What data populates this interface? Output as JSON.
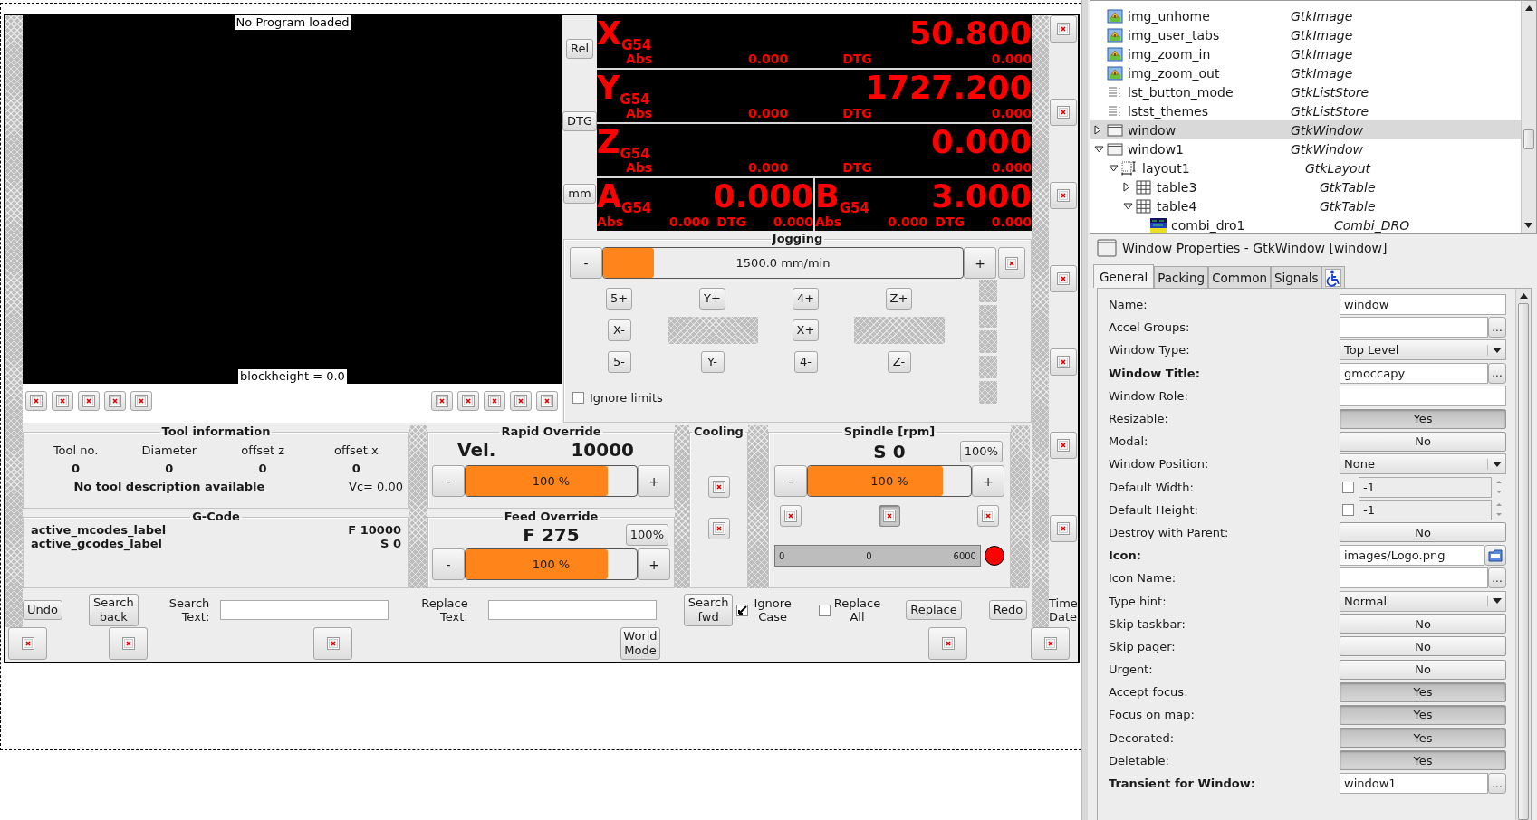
{
  "canvas": {
    "app": {
      "preview": {
        "title": "No Program loaded",
        "footer": "blockheight = 0.0"
      },
      "dro_buttons": [
        "Rel",
        "DTG",
        "mm"
      ],
      "dro": {
        "rows": [
          {
            "axes": [
              {
                "letter": "X",
                "system": "G54",
                "value": "50.800",
                "abs_label": "Abs",
                "abs_value": "0.000",
                "dtg_label": "DTG",
                "dtg_value": "0.000"
              }
            ]
          },
          {
            "axes": [
              {
                "letter": "Y",
                "system": "G54",
                "value": "1727.200",
                "abs_label": "Abs",
                "abs_value": "0.000",
                "dtg_label": "DTG",
                "dtg_value": "0.000"
              }
            ]
          },
          {
            "axes": [
              {
                "letter": "Z",
                "system": "G54",
                "value": "0.000",
                "abs_label": "Abs",
                "abs_value": "0.000",
                "dtg_label": "DTG",
                "dtg_value": "0.000"
              }
            ]
          },
          {
            "axes": [
              {
                "letter": "A",
                "system": "G54",
                "value": "0.000",
                "abs_label": "Abs",
                "abs_value": "0.000",
                "dtg_label": "DTG",
                "dtg_value": "0.000"
              },
              {
                "letter": "B",
                "system": "G54",
                "value": "3.000",
                "abs_label": "Abs",
                "abs_value": "0.000",
                "dtg_label": "DTG",
                "dtg_value": "0.000"
              }
            ]
          }
        ]
      },
      "jogging": {
        "title": "Jogging",
        "speed": {
          "minus": "-",
          "plus": "+",
          "reading": "1500.0 mm/min",
          "level": 0.14
        },
        "grid": [
          {
            "kind": "button",
            "label": "5+"
          },
          {
            "kind": "button",
            "label": "Y+"
          },
          {
            "kind": "button",
            "label": "4+"
          },
          {
            "kind": "button",
            "label": "Z+"
          },
          {
            "kind": "button",
            "label": "X-"
          },
          {
            "kind": "placeholder"
          },
          {
            "kind": "button",
            "label": "X+"
          },
          {
            "kind": "placeholder"
          },
          {
            "kind": "button",
            "label": "5-"
          },
          {
            "kind": "button",
            "label": "Y-"
          },
          {
            "kind": "button",
            "label": "4-"
          },
          {
            "kind": "button",
            "label": "Z-"
          }
        ],
        "ignore_limits": {
          "label": "Ignore limits",
          "checked": false
        }
      },
      "tool_info": {
        "title": "Tool information",
        "columns": [
          "Tool no.",
          "Diameter",
          "offset z",
          "offset x"
        ],
        "values": [
          "0",
          "0",
          "0",
          "0"
        ],
        "description": "No tool description available",
        "vc": "Vc= 0.00"
      },
      "gcode": {
        "title": "G-Code",
        "rows": [
          {
            "label": "active_mcodes_label",
            "value": "F 10000"
          },
          {
            "label": "active_gcodes_label",
            "value": "S 0"
          }
        ]
      },
      "rapid_override": {
        "title": "Rapid Override",
        "label": "Vel.",
        "value": "10000",
        "slider": {
          "minus": "-",
          "plus": "+",
          "reading": "100 %",
          "level": 0.83
        }
      },
      "feed_override": {
        "title": "Feed Override",
        "value": "F 275",
        "reset": "100%",
        "slider": {
          "minus": "-",
          "plus": "+",
          "reading": "100 %",
          "level": 0.83
        }
      },
      "cooling": {
        "title": "Cooling"
      },
      "spindle": {
        "title": "Spindle [rpm]",
        "value": "S 0",
        "reset": "100%",
        "slider": {
          "minus": "-",
          "plus": "+",
          "reading": "100 %",
          "level": 0.83
        },
        "direction_buttons": [
          {
            "selected": false
          },
          {
            "selected": true
          },
          {
            "selected": false
          }
        ],
        "gauge": {
          "min": "0",
          "value": "0",
          "max": "6000"
        },
        "led": {
          "on": true
        }
      },
      "search_bar": {
        "undo": "Undo",
        "search_back": "Search\nback",
        "search_label": "Search\nText:",
        "replace_label": "Replace\nText:",
        "search_fwd": "Search\nfwd",
        "ignore_case": {
          "label": "Ignore\nCase",
          "checked": true
        },
        "replace_all": {
          "label": "Replace\nAll",
          "checked": false
        },
        "replace": "Replace",
        "redo": "Redo"
      },
      "time_date": "Time\nDate",
      "world_mode": "World\nMode"
    }
  },
  "object_tree": {
    "items": [
      {
        "name": "img_unhome",
        "type": "GtkImage",
        "kind": "image",
        "selected": false
      },
      {
        "name": "img_user_tabs",
        "type": "GtkImage",
        "kind": "image",
        "selected": false
      },
      {
        "name": "img_zoom_in",
        "type": "GtkImage",
        "kind": "image",
        "selected": false
      },
      {
        "name": "img_zoom_out",
        "type": "GtkImage",
        "kind": "image",
        "selected": false
      },
      {
        "name": "lst_button_mode",
        "type": "GtkListStore",
        "kind": "liststore",
        "selected": false
      },
      {
        "name": "lstst_themes",
        "type": "GtkListStore",
        "kind": "liststore",
        "selected": false
      },
      {
        "name": "window",
        "type": "GtkWindow",
        "kind": "window",
        "expanded": false,
        "selected": true
      },
      {
        "name": "window1",
        "type": "GtkWindow",
        "kind": "window",
        "expanded": true,
        "selected": false,
        "children": [
          {
            "name": "layout1",
            "type": "GtkLayout",
            "kind": "layout",
            "expanded": true,
            "selected": false,
            "children": [
              {
                "name": "table3",
                "type": "GtkTable",
                "kind": "table",
                "expanded": false,
                "selected": false
              },
              {
                "name": "table4",
                "type": "GtkTable",
                "kind": "table",
                "expanded": true,
                "selected": false,
                "children": [
                  {
                    "name": "combi_dro1",
                    "type": "Combi_DRO",
                    "kind": "dro",
                    "selected": false
                  }
                ]
              }
            ]
          }
        ]
      }
    ]
  },
  "properties": {
    "header": "Window Properties - GtkWindow [window]",
    "tabs": [
      {
        "kind": "text",
        "label": "General",
        "selected": true
      },
      {
        "kind": "text",
        "label": "Packing",
        "selected": false
      },
      {
        "kind": "text",
        "label": "Common",
        "selected": false
      },
      {
        "kind": "text",
        "label": "Signals",
        "selected": false
      },
      {
        "kind": "icon",
        "selected": false
      }
    ],
    "rows": [
      {
        "label": "Name:",
        "bold": false,
        "kind": "text",
        "value": "window"
      },
      {
        "label": "Accel Groups:",
        "bold": false,
        "kind": "text_button",
        "button": "..."
      },
      {
        "label": "Window Type:",
        "bold": false,
        "kind": "combo",
        "value": "Top Level"
      },
      {
        "label": "Window Title:",
        "bold": true,
        "kind": "text_button",
        "value": "gmoccapy",
        "button": "..."
      },
      {
        "label": "Window Role:",
        "bold": false,
        "kind": "text"
      },
      {
        "label": "Resizable:",
        "bold": false,
        "kind": "toggle",
        "value": "Yes",
        "on": true
      },
      {
        "label": "Modal:",
        "bold": false,
        "kind": "toggle",
        "value": "No",
        "on": false
      },
      {
        "label": "Window Position:",
        "bold": false,
        "kind": "combo",
        "value": "None"
      },
      {
        "label": "Default Width:",
        "bold": false,
        "kind": "spin",
        "value": "-1",
        "checked": false
      },
      {
        "label": "Default Height:",
        "bold": false,
        "kind": "spin",
        "value": "-1",
        "checked": false
      },
      {
        "label": "Destroy with Parent:",
        "bold": false,
        "kind": "toggle",
        "value": "No",
        "on": false
      },
      {
        "label": "Icon:",
        "bold": true,
        "kind": "file",
        "value": "images/Logo.png"
      },
      {
        "label": "Icon Name:",
        "bold": false,
        "kind": "text_button",
        "button": "..."
      },
      {
        "label": "Type hint:",
        "bold": false,
        "kind": "combo",
        "value": "Normal"
      },
      {
        "label": "Skip taskbar:",
        "bold": false,
        "kind": "toggle",
        "value": "No",
        "on": false
      },
      {
        "label": "Skip pager:",
        "bold": false,
        "kind": "toggle",
        "value": "No",
        "on": false
      },
      {
        "label": "Urgent:",
        "bold": false,
        "kind": "toggle",
        "value": "No",
        "on": false
      },
      {
        "label": "Accept focus:",
        "bold": false,
        "kind": "toggle",
        "value": "Yes",
        "on": true
      },
      {
        "label": "Focus on map:",
        "bold": false,
        "kind": "toggle",
        "value": "Yes",
        "on": true
      },
      {
        "label": "Decorated:",
        "bold": false,
        "kind": "toggle",
        "value": "Yes",
        "on": true
      },
      {
        "label": "Deletable:",
        "bold": false,
        "kind": "toggle",
        "value": "Yes",
        "on": true
      },
      {
        "label": "Transient for Window:",
        "bold": true,
        "kind": "text_button",
        "value": "window1",
        "button": "..."
      }
    ]
  }
}
